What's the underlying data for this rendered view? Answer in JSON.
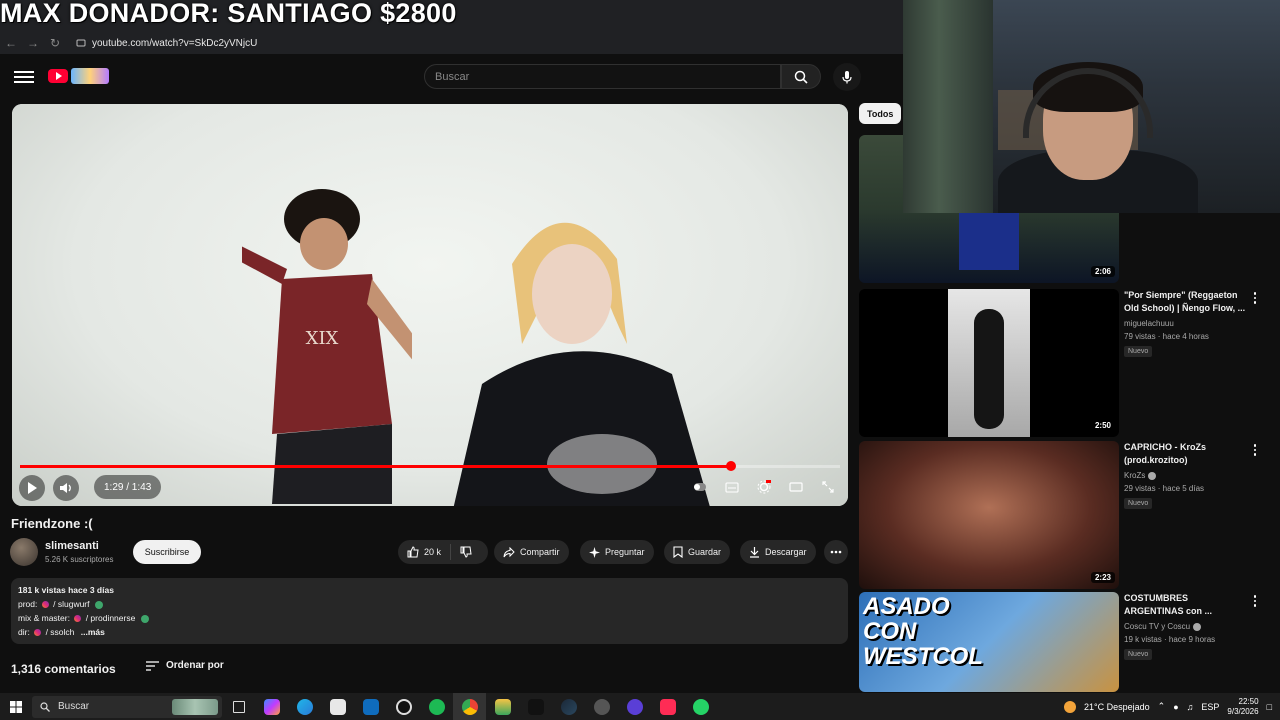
{
  "stream": {
    "donor_banner": "MAX DONADOR: SANTIAGO $2800"
  },
  "browser": {
    "url": "youtube.com/watch?v=SkDc2yVNjcU"
  },
  "header": {
    "search_placeholder": "Buscar"
  },
  "player": {
    "time": "1:29 / 1:43",
    "progress_fraction": 0.867
  },
  "video": {
    "title": "Friendzone :(",
    "channel": "slimesanti",
    "subscribers": "5.26 K suscriptores",
    "subscribe_label": "Suscribirse",
    "likes": "20 k",
    "share_label": "Compartir",
    "ask_label": "Preguntar",
    "save_label": "Guardar",
    "download_label": "Descargar"
  },
  "description": {
    "stats": "181 k vistas  hace 3 días",
    "line1_label": "prod:",
    "line1_handle": "/ slugwurf",
    "line2_label": "mix & master:",
    "line2_handle": "/ prodinnerse",
    "line3_label": "dir:",
    "line3_handle": "/ ssolch",
    "more": "...más"
  },
  "comments": {
    "count": "1,316 comentarios",
    "sort_label": "Ordenar por"
  },
  "sidebar": {
    "chip": "Todos",
    "items": [
      {
        "title": "",
        "channel": "",
        "stats": "",
        "badge": "",
        "duration": "2:06"
      },
      {
        "title": "\"Por Siempre\" (Reggaeton Old School) | Ñengo Flow, ...",
        "channel": "miguelachuuu",
        "stats": "79 vistas · hace 4 horas",
        "badge": "Nuevo",
        "duration": "2:50"
      },
      {
        "title": "CAPRICHO - KroZs (prod.krozitoo)",
        "channel": "KroZs",
        "stats": "29 vistas · hace 5 días",
        "badge": "Nuevo",
        "duration": "2:23"
      },
      {
        "title": "COSTUMBRES ARGENTINAS con ...",
        "channel": "Coscu TV y Coscu",
        "stats": "19 k vistas · hace 9 horas",
        "badge": "Nuevo",
        "duration": ""
      }
    ],
    "thumb4_text": "ASADO CON WESTCOL"
  },
  "taskbar": {
    "search_label": "Buscar",
    "weather": "21°C  Despejado",
    "lang": "ESP",
    "time": "22:50",
    "date": "9/3/2026"
  },
  "colors": {
    "accent": "#ff0000",
    "background": "#0f0f0f",
    "panel": "#272727"
  }
}
